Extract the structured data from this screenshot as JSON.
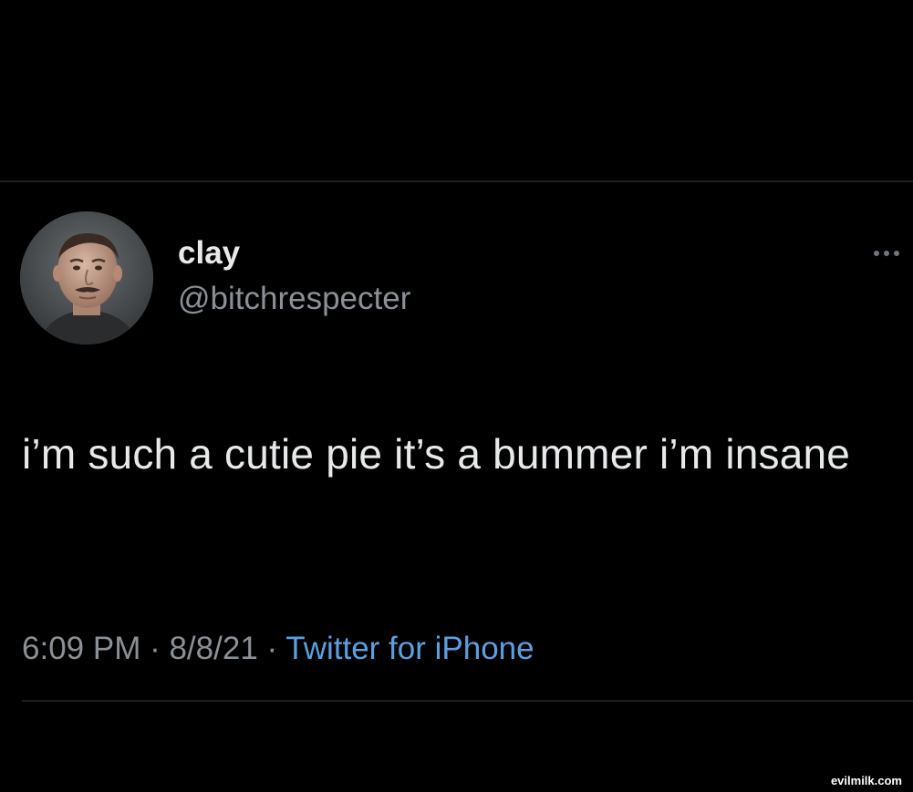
{
  "tweet": {
    "display_name": "clay",
    "handle": "@bitchrespecter",
    "text": "i’m such a cutie pie it’s a bummer i’m insane",
    "time": "6:09 PM",
    "date": "8/8/21",
    "separator": " · ",
    "source": "Twitter for iPhone",
    "more_icon": "more-horizontal-icon"
  },
  "watermark": "evilmilk.com",
  "colors": {
    "background": "#000000",
    "text": "#e7e9ea",
    "secondary": "#8b9096",
    "link": "#5aa0e0"
  }
}
